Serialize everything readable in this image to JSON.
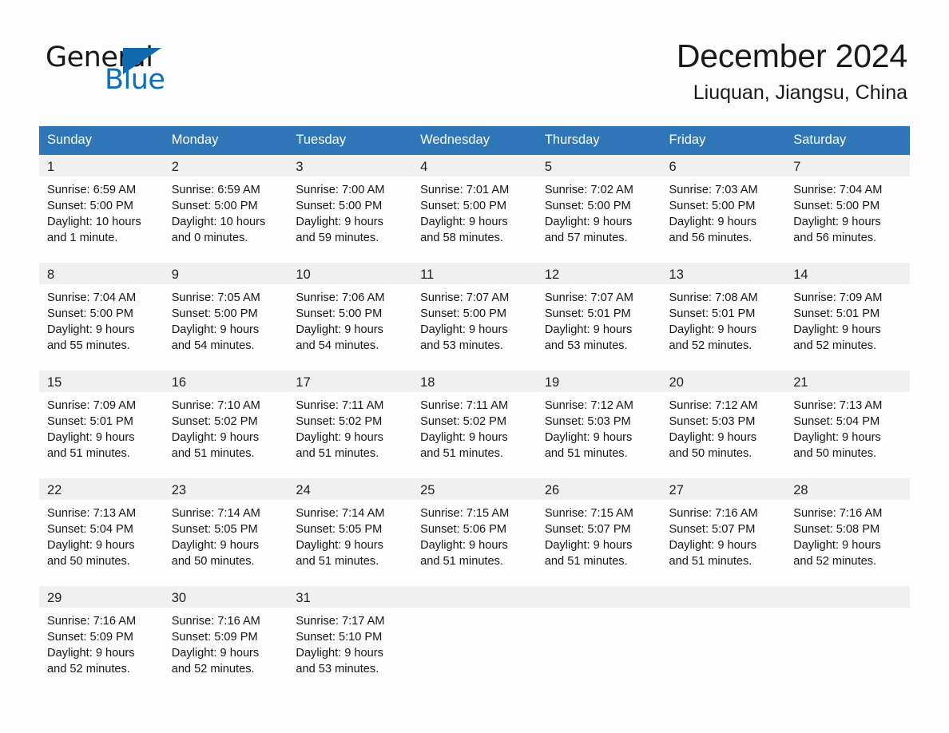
{
  "brand": {
    "name_part1": "General",
    "name_part2": "Blue",
    "triangle_color": "#1268ac",
    "blue_text_color": "#0b6fc1"
  },
  "header": {
    "title": "December 2024",
    "location": "Liuquan, Jiangsu, China"
  },
  "colors": {
    "header_blue": "#2e76b8",
    "daynum_bg": "#f0f0f0",
    "page_bg": "#fdfdfd",
    "text": "#161616"
  },
  "weekday_headers": [
    "Sunday",
    "Monday",
    "Tuesday",
    "Wednesday",
    "Thursday",
    "Friday",
    "Saturday"
  ],
  "weeks": [
    [
      {
        "day": "1",
        "sunrise": "Sunrise: 6:59 AM",
        "sunset": "Sunset: 5:00 PM",
        "daylight_line1": "Daylight: 10 hours",
        "daylight_line2": "and 1 minute."
      },
      {
        "day": "2",
        "sunrise": "Sunrise: 6:59 AM",
        "sunset": "Sunset: 5:00 PM",
        "daylight_line1": "Daylight: 10 hours",
        "daylight_line2": "and 0 minutes."
      },
      {
        "day": "3",
        "sunrise": "Sunrise: 7:00 AM",
        "sunset": "Sunset: 5:00 PM",
        "daylight_line1": "Daylight: 9 hours",
        "daylight_line2": "and 59 minutes."
      },
      {
        "day": "4",
        "sunrise": "Sunrise: 7:01 AM",
        "sunset": "Sunset: 5:00 PM",
        "daylight_line1": "Daylight: 9 hours",
        "daylight_line2": "and 58 minutes."
      },
      {
        "day": "5",
        "sunrise": "Sunrise: 7:02 AM",
        "sunset": "Sunset: 5:00 PM",
        "daylight_line1": "Daylight: 9 hours",
        "daylight_line2": "and 57 minutes."
      },
      {
        "day": "6",
        "sunrise": "Sunrise: 7:03 AM",
        "sunset": "Sunset: 5:00 PM",
        "daylight_line1": "Daylight: 9 hours",
        "daylight_line2": "and 56 minutes."
      },
      {
        "day": "7",
        "sunrise": "Sunrise: 7:04 AM",
        "sunset": "Sunset: 5:00 PM",
        "daylight_line1": "Daylight: 9 hours",
        "daylight_line2": "and 56 minutes."
      }
    ],
    [
      {
        "day": "8",
        "sunrise": "Sunrise: 7:04 AM",
        "sunset": "Sunset: 5:00 PM",
        "daylight_line1": "Daylight: 9 hours",
        "daylight_line2": "and 55 minutes."
      },
      {
        "day": "9",
        "sunrise": "Sunrise: 7:05 AM",
        "sunset": "Sunset: 5:00 PM",
        "daylight_line1": "Daylight: 9 hours",
        "daylight_line2": "and 54 minutes."
      },
      {
        "day": "10",
        "sunrise": "Sunrise: 7:06 AM",
        "sunset": "Sunset: 5:00 PM",
        "daylight_line1": "Daylight: 9 hours",
        "daylight_line2": "and 54 minutes."
      },
      {
        "day": "11",
        "sunrise": "Sunrise: 7:07 AM",
        "sunset": "Sunset: 5:00 PM",
        "daylight_line1": "Daylight: 9 hours",
        "daylight_line2": "and 53 minutes."
      },
      {
        "day": "12",
        "sunrise": "Sunrise: 7:07 AM",
        "sunset": "Sunset: 5:01 PM",
        "daylight_line1": "Daylight: 9 hours",
        "daylight_line2": "and 53 minutes."
      },
      {
        "day": "13",
        "sunrise": "Sunrise: 7:08 AM",
        "sunset": "Sunset: 5:01 PM",
        "daylight_line1": "Daylight: 9 hours",
        "daylight_line2": "and 52 minutes."
      },
      {
        "day": "14",
        "sunrise": "Sunrise: 7:09 AM",
        "sunset": "Sunset: 5:01 PM",
        "daylight_line1": "Daylight: 9 hours",
        "daylight_line2": "and 52 minutes."
      }
    ],
    [
      {
        "day": "15",
        "sunrise": "Sunrise: 7:09 AM",
        "sunset": "Sunset: 5:01 PM",
        "daylight_line1": "Daylight: 9 hours",
        "daylight_line2": "and 51 minutes."
      },
      {
        "day": "16",
        "sunrise": "Sunrise: 7:10 AM",
        "sunset": "Sunset: 5:02 PM",
        "daylight_line1": "Daylight: 9 hours",
        "daylight_line2": "and 51 minutes."
      },
      {
        "day": "17",
        "sunrise": "Sunrise: 7:11 AM",
        "sunset": "Sunset: 5:02 PM",
        "daylight_line1": "Daylight: 9 hours",
        "daylight_line2": "and 51 minutes."
      },
      {
        "day": "18",
        "sunrise": "Sunrise: 7:11 AM",
        "sunset": "Sunset: 5:02 PM",
        "daylight_line1": "Daylight: 9 hours",
        "daylight_line2": "and 51 minutes."
      },
      {
        "day": "19",
        "sunrise": "Sunrise: 7:12 AM",
        "sunset": "Sunset: 5:03 PM",
        "daylight_line1": "Daylight: 9 hours",
        "daylight_line2": "and 51 minutes."
      },
      {
        "day": "20",
        "sunrise": "Sunrise: 7:12 AM",
        "sunset": "Sunset: 5:03 PM",
        "daylight_line1": "Daylight: 9 hours",
        "daylight_line2": "and 50 minutes."
      },
      {
        "day": "21",
        "sunrise": "Sunrise: 7:13 AM",
        "sunset": "Sunset: 5:04 PM",
        "daylight_line1": "Daylight: 9 hours",
        "daylight_line2": "and 50 minutes."
      }
    ],
    [
      {
        "day": "22",
        "sunrise": "Sunrise: 7:13 AM",
        "sunset": "Sunset: 5:04 PM",
        "daylight_line1": "Daylight: 9 hours",
        "daylight_line2": "and 50 minutes."
      },
      {
        "day": "23",
        "sunrise": "Sunrise: 7:14 AM",
        "sunset": "Sunset: 5:05 PM",
        "daylight_line1": "Daylight: 9 hours",
        "daylight_line2": "and 50 minutes."
      },
      {
        "day": "24",
        "sunrise": "Sunrise: 7:14 AM",
        "sunset": "Sunset: 5:05 PM",
        "daylight_line1": "Daylight: 9 hours",
        "daylight_line2": "and 51 minutes."
      },
      {
        "day": "25",
        "sunrise": "Sunrise: 7:15 AM",
        "sunset": "Sunset: 5:06 PM",
        "daylight_line1": "Daylight: 9 hours",
        "daylight_line2": "and 51 minutes."
      },
      {
        "day": "26",
        "sunrise": "Sunrise: 7:15 AM",
        "sunset": "Sunset: 5:07 PM",
        "daylight_line1": "Daylight: 9 hours",
        "daylight_line2": "and 51 minutes."
      },
      {
        "day": "27",
        "sunrise": "Sunrise: 7:16 AM",
        "sunset": "Sunset: 5:07 PM",
        "daylight_line1": "Daylight: 9 hours",
        "daylight_line2": "and 51 minutes."
      },
      {
        "day": "28",
        "sunrise": "Sunrise: 7:16 AM",
        "sunset": "Sunset: 5:08 PM",
        "daylight_line1": "Daylight: 9 hours",
        "daylight_line2": "and 52 minutes."
      }
    ],
    [
      {
        "day": "29",
        "sunrise": "Sunrise: 7:16 AM",
        "sunset": "Sunset: 5:09 PM",
        "daylight_line1": "Daylight: 9 hours",
        "daylight_line2": "and 52 minutes."
      },
      {
        "day": "30",
        "sunrise": "Sunrise: 7:16 AM",
        "sunset": "Sunset: 5:09 PM",
        "daylight_line1": "Daylight: 9 hours",
        "daylight_line2": "and 52 minutes."
      },
      {
        "day": "31",
        "sunrise": "Sunrise: 7:17 AM",
        "sunset": "Sunset: 5:10 PM",
        "daylight_line1": "Daylight: 9 hours",
        "daylight_line2": "and 53 minutes."
      },
      {
        "day": "",
        "sunrise": "",
        "sunset": "",
        "daylight_line1": "",
        "daylight_line2": ""
      },
      {
        "day": "",
        "sunrise": "",
        "sunset": "",
        "daylight_line1": "",
        "daylight_line2": ""
      },
      {
        "day": "",
        "sunrise": "",
        "sunset": "",
        "daylight_line1": "",
        "daylight_line2": ""
      },
      {
        "day": "",
        "sunrise": "",
        "sunset": "",
        "daylight_line1": "",
        "daylight_line2": ""
      }
    ]
  ]
}
